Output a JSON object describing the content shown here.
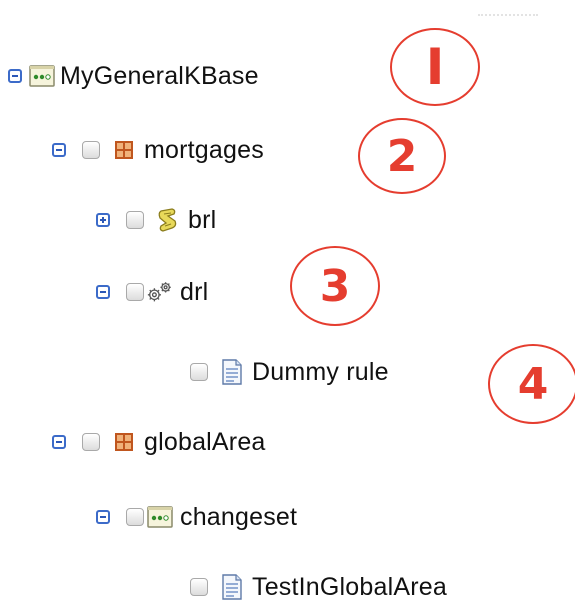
{
  "tree": {
    "nodes": [
      {
        "label": "MyGeneralKBase",
        "toggle": "minus",
        "icon": "kbase-icon",
        "checkbox": false
      },
      {
        "label": "mortgages",
        "toggle": "minus",
        "icon": "package-icon",
        "checkbox": true
      },
      {
        "label": "brl",
        "toggle": "plus",
        "icon": "scroll-icon",
        "checkbox": true
      },
      {
        "label": "drl",
        "toggle": "minus",
        "icon": "gears-icon",
        "checkbox": true
      },
      {
        "label": "Dummy rule",
        "toggle": "none",
        "icon": "document-icon",
        "checkbox": true
      },
      {
        "label": "globalArea",
        "toggle": "minus",
        "icon": "package-icon",
        "checkbox": true
      },
      {
        "label": "changeset",
        "toggle": "minus",
        "icon": "kbase-icon",
        "checkbox": true
      },
      {
        "label": "TestInGlobalArea",
        "toggle": "none",
        "icon": "document-icon",
        "checkbox": true
      }
    ]
  },
  "annotations": {
    "one": "I",
    "two": "2",
    "three": "3",
    "four": "4"
  },
  "colors": {
    "accent_red": "#e53d2f",
    "toggle_blue": "#2c58b7",
    "kbase_green": "#3b8a2c",
    "package_orange": "#d9702b"
  }
}
